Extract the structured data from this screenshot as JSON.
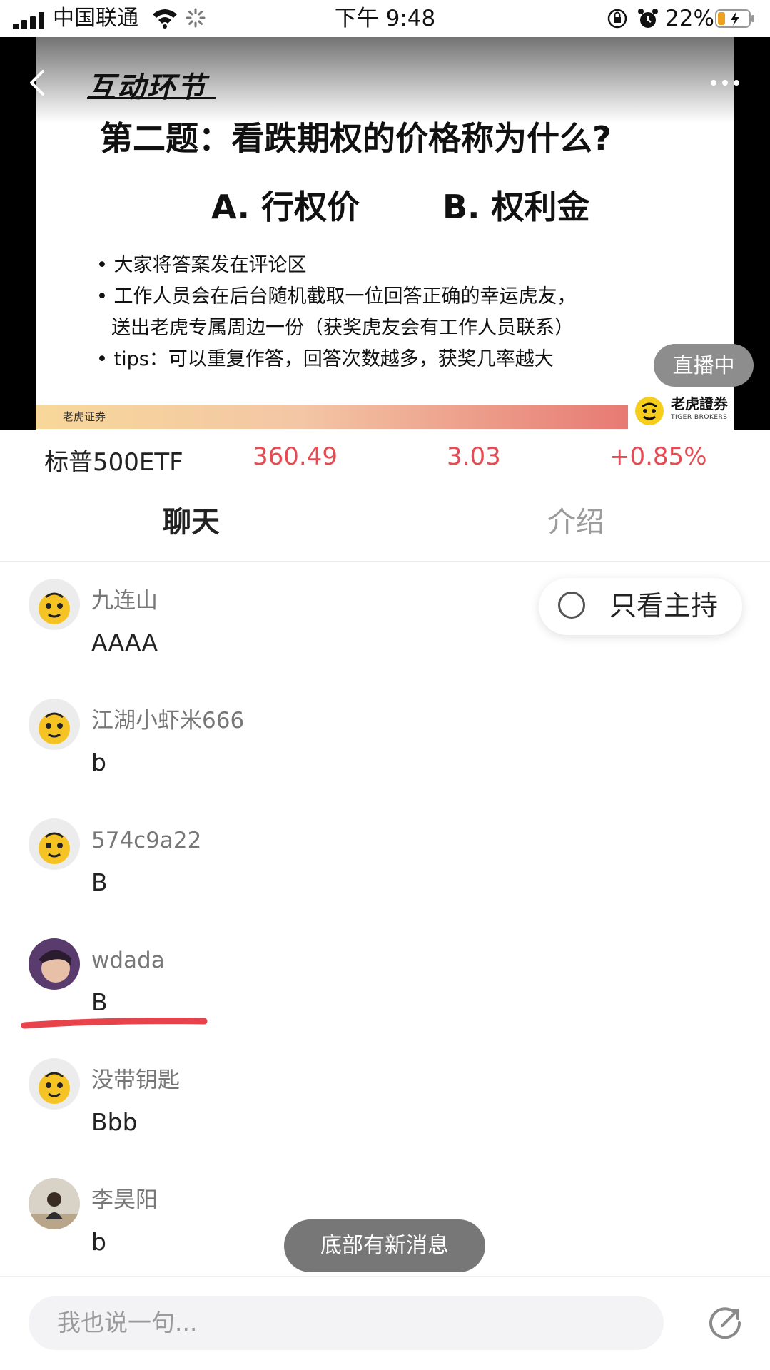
{
  "status_bar": {
    "carrier": "中国联通",
    "time": "下午 9:48",
    "battery": "22%",
    "icons": [
      "signal-icon",
      "wifi-icon",
      "loading-icon",
      "orientation-lock-icon",
      "alarm-icon",
      "battery-icon"
    ]
  },
  "video": {
    "slide_title": "互动环节",
    "question": "第二题：看跌期权的价格称为什么?",
    "option_a": "A. 行权价",
    "option_b": "B. 权利金",
    "bullets": [
      "• 大家将答案发在评论区",
      "• 工作人员会在后台随机截取一位回答正确的幸运虎友，",
      "送出老虎专属周边一份（获奖虎友会有工作人员联系）",
      "• tips：可以重复作答，回答次数越多，获奖几率越大"
    ],
    "live_badge": "直播中",
    "footer_left": "老虎证券",
    "brand_name": "老虎證券",
    "brand_sub": "TIGER BROKERS"
  },
  "ticker": {
    "name": "标普500ETF",
    "price": "360.49",
    "change": "3.03",
    "percent": "+0.85%",
    "up_color": "#e44b52"
  },
  "tabs": [
    "聊天",
    "介绍"
  ],
  "host_filter": {
    "label": "只看主持",
    "checked": false
  },
  "messages": [
    {
      "user": "九连山",
      "text": "AAAA",
      "avatar": "tiger-avatar"
    },
    {
      "user": "江湖小虾米666",
      "text": "b",
      "avatar": "tiger-avatar"
    },
    {
      "user": "574c9a22",
      "text": "B",
      "avatar": "tiger-avatar"
    },
    {
      "user": "wdada",
      "text": "B",
      "avatar": "photo-avatar",
      "highlighted": true
    },
    {
      "user": "没带钥匙",
      "text": "Bbb",
      "avatar": "tiger-avatar"
    },
    {
      "user": "李昊阳",
      "text": "b",
      "avatar": "photo-avatar"
    }
  ],
  "new_message_pill": "底部有新消息",
  "input": {
    "placeholder": "我也说一句..."
  }
}
